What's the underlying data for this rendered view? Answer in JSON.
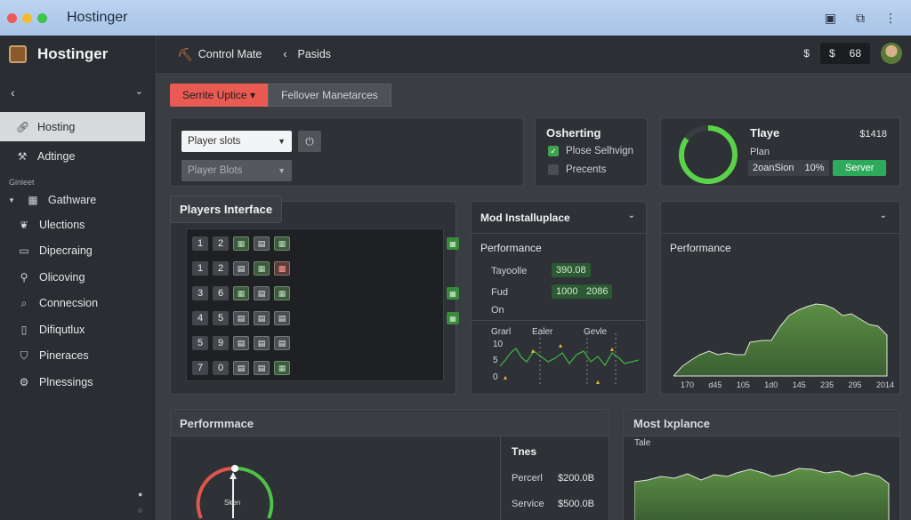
{
  "window": {
    "title": "Hostinger"
  },
  "sidebar": {
    "brand": "Hostinger",
    "section_label": "Ginleet",
    "items": [
      {
        "label": "Hosting",
        "icon": "link-icon",
        "active": true
      },
      {
        "label": "Adtinge",
        "icon": "wrench-icon",
        "active": false
      }
    ],
    "group": {
      "label": "Gathware",
      "icon": "grid-icon"
    },
    "subitems": [
      {
        "label": "Ulections",
        "icon": "leaf-icon"
      },
      {
        "label": "Dipecraing",
        "icon": "card-icon"
      },
      {
        "label": "Olicoving",
        "icon": "link-icon"
      },
      {
        "label": "Connecsion",
        "icon": "search-icon"
      },
      {
        "label": "Difiqutlux",
        "icon": "document-icon"
      },
      {
        "label": "Pineraces",
        "icon": "shield-icon"
      },
      {
        "label": "Plnessings",
        "icon": "settings-icon"
      }
    ]
  },
  "header": {
    "control_label": "Control Mate",
    "crumb_label": "Pasids",
    "dollar": "$",
    "count_a": "$",
    "count_b": "68"
  },
  "tabs": [
    {
      "label": "Serrite Uptice ▾",
      "active": true
    },
    {
      "label": "Fellover Manetarces",
      "active": false
    }
  ],
  "filters": {
    "select1": "Player slots",
    "select2": "Player Blots"
  },
  "osherting": {
    "title": "Osherting",
    "options": [
      {
        "label": "Plose Selhvign",
        "checked": true
      },
      {
        "label": "Precents",
        "checked": false
      }
    ]
  },
  "plan": {
    "title": "Tlaye",
    "price": "$1418",
    "plan_label": "Plan",
    "name": "2oanSion",
    "percent": "10%",
    "button": "Server",
    "progress": 0.85
  },
  "players": {
    "title": "Players Interface",
    "rows": [
      {
        "a": "1",
        "b": "2",
        "icons": [
          "g",
          "w",
          "g"
        ],
        "badge": true
      },
      {
        "a": "1",
        "b": "2",
        "icons": [
          "w",
          "g",
          "r"
        ],
        "badge": false
      },
      {
        "a": "3",
        "b": "6",
        "icons": [
          "g",
          "w",
          "g"
        ],
        "badge": true
      },
      {
        "a": "4",
        "b": "5",
        "icons": [
          "w",
          "w",
          "w"
        ],
        "badge": true
      },
      {
        "a": "5",
        "b": "9",
        "icons": [
          "w",
          "w",
          "w"
        ],
        "badge": false
      },
      {
        "a": "7",
        "b": "0",
        "icons": [
          "w",
          "w",
          "g"
        ],
        "badge": false
      }
    ]
  },
  "mod_install": {
    "title": "Mod Installuplace",
    "section": "Performance",
    "rows": [
      {
        "label": "Tayoolle",
        "value": "390.08"
      },
      {
        "label": "Fud",
        "value": "1000",
        "value2": "2086"
      },
      {
        "label": "On",
        "value": ""
      }
    ],
    "chart_header": [
      "Grarl",
      "Ealer",
      "Gevle"
    ],
    "chart_ticks": [
      "10",
      "5",
      "0"
    ]
  },
  "performance_right": {
    "title": "Performance",
    "x_ticks": [
      "170",
      "d45",
      "105",
      "1d0",
      "145",
      "235",
      "295",
      "2014"
    ]
  },
  "performance_bottom": {
    "title": "Performmace",
    "gauge_label": "Sken",
    "table_title": "Tnes",
    "rows": [
      {
        "label": "Percerl",
        "value": "$200.0B"
      },
      {
        "label": "Service",
        "value": "$500.0B"
      }
    ]
  },
  "most_explance": {
    "title": "Most Ixplance",
    "subtitle": "Tale"
  },
  "colors": {
    "accent_red": "#e85a52",
    "accent_green": "#2eab5a",
    "panel": "#2e3135"
  }
}
